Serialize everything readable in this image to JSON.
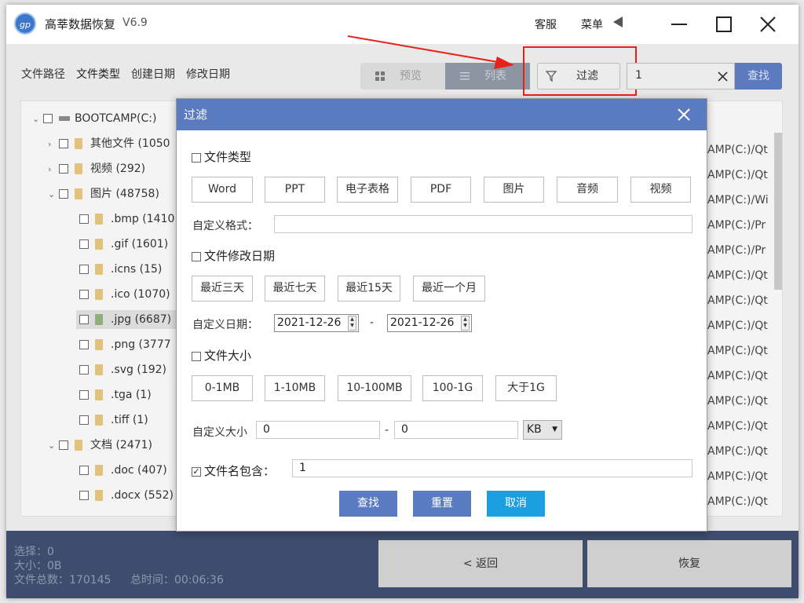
{
  "app": {
    "title": "高莘数据恢复",
    "version": "V6.9",
    "logo": "gp"
  },
  "titlebar": {
    "service": "客服",
    "menu": "菜单"
  },
  "nav": {
    "tabs": [
      "文件路径",
      "文件类型",
      "创建日期",
      "修改日期"
    ]
  },
  "toolbar": {
    "preview": "预览",
    "list": "列表",
    "filter": "过滤",
    "search_value": "1",
    "search_button": "查找"
  },
  "tree": {
    "root": "BOOTCAMP(C:)",
    "items": [
      "其他文件 (1050",
      "视频 (292)",
      "图片 (48758)",
      ".bmp (1410",
      ".gif (1601)",
      ".icns (15)",
      ".ico (1070)",
      ".jpg (6687)",
      ".png (3777",
      ".svg (192)",
      ".tga (1)",
      ".tiff (1)",
      "文档 (2471)",
      ".doc (407)",
      ".docx (552)"
    ]
  },
  "paths": [
    "AMP(C:)/Qt",
    "AMP(C:)/Qt",
    "AMP(C:)/Wi",
    "AMP(C:)/Pr",
    "AMP(C:)/Pr",
    "AMP(C:)/Qt",
    "AMP(C:)/Qt",
    "AMP(C:)/Qt",
    "AMP(C:)/Qt",
    "AMP(C:)/Qt",
    "AMP(C:)/Qt",
    "AMP(C:)/Qt",
    "AMP(C:)/Qt",
    "AMP(C:)/Qt",
    "AMP(C:)/Qt"
  ],
  "footer": {
    "selected": "选择：0",
    "size": "大小：0B",
    "total": "文件总数：170145",
    "time": "总时间：00:06:36",
    "back": "< 返回",
    "recover": "恢复"
  },
  "dialog": {
    "title": "过滤",
    "file_type": {
      "label": "文件类型",
      "options": [
        "Word",
        "PPT",
        "电子表格",
        "PDF",
        "图片",
        "音频",
        "视频"
      ],
      "custom_label": "自定义格式：",
      "custom_value": ""
    },
    "modified": {
      "label": "文件修改日期",
      "options": [
        "最近三天",
        "最近七天",
        "最近15天",
        "最近一个月"
      ],
      "custom_label": "自定义日期：",
      "start": "2021-12-26",
      "separator": "-",
      "end": "2021-12-26"
    },
    "size": {
      "label": "文件大小",
      "options": [
        "0-1MB",
        "1-10MB",
        "10-100MB",
        "100-1G",
        "大于1G"
      ],
      "custom_label": "自定义大小",
      "min": "0",
      "separator": "-",
      "max": "0",
      "unit": "KB"
    },
    "name": {
      "label": "文件名包含：",
      "checked": true,
      "value": "1"
    },
    "buttons": {
      "search": "查找",
      "reset": "重置",
      "cancel": "取消"
    },
    "colors": {
      "header": "#5b7bc0",
      "button_blue": "#5b7bc0",
      "button_cyan": "#1a9fe0"
    }
  }
}
